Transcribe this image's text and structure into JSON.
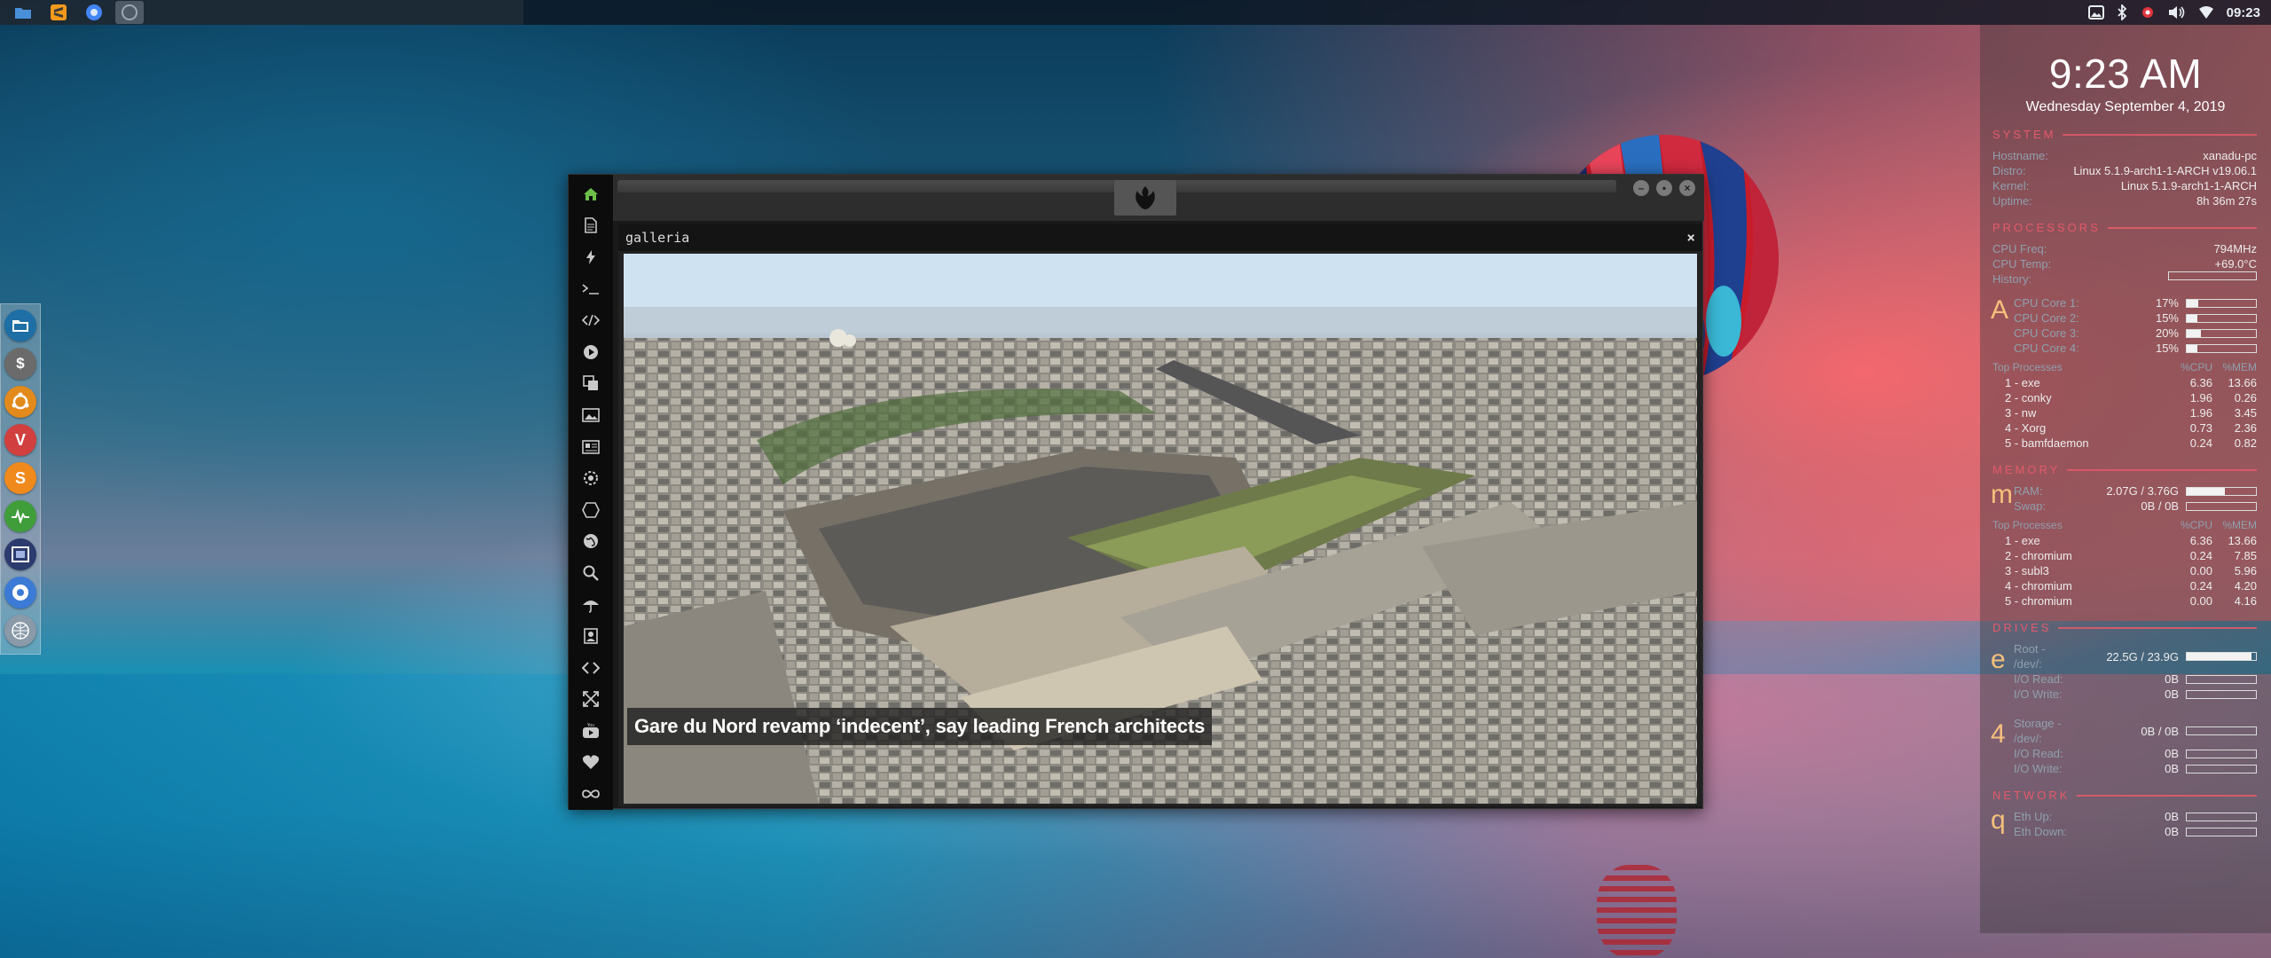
{
  "taskbar": {
    "launchers": [
      {
        "icon": "folder-icon",
        "color": "#4a90d9"
      },
      {
        "icon": "sublime-icon",
        "color": "#f29a1b"
      },
      {
        "icon": "chromium-icon",
        "color": "#4285f4"
      },
      {
        "icon": "app-icon",
        "color": "#556677"
      }
    ],
    "tray": {
      "icons": [
        "image-icon",
        "bluetooth-icon",
        "gear-icon",
        "volume-icon",
        "wifi-icon"
      ],
      "clock": "09:23"
    }
  },
  "dock": {
    "items": [
      {
        "icon": "file-manager-icon",
        "color": "#1d6fa5"
      },
      {
        "icon": "terminal-icon",
        "color": "#6b6b6b"
      },
      {
        "icon": "ubuntu-icon",
        "color": "#e38a1d"
      },
      {
        "icon": "vivaldi-icon",
        "color": "#d13f3f"
      },
      {
        "icon": "sublime-icon",
        "color": "#f08a1c"
      },
      {
        "icon": "system-monitor-icon",
        "color": "#3f9d3a"
      },
      {
        "icon": "screenshot-icon",
        "color": "#2b3b6e"
      },
      {
        "icon": "chromium-icon",
        "color": "#3b7bd6"
      },
      {
        "icon": "network-icon",
        "color": "#8a9aa8"
      }
    ]
  },
  "app": {
    "sidebar_icons": [
      "home-icon",
      "document-icon",
      "lightning-icon",
      "terminal-icon",
      "code-icon",
      "play-icon",
      "copy-icon",
      "image-icon",
      "news-icon",
      "settings-icon",
      "hexagon-icon",
      "globe-icon",
      "search-icon",
      "umbrella-icon",
      "contact-icon",
      "embed-icon",
      "expand-icon",
      "youtube-icon",
      "heart-icon",
      "infinity-icon"
    ],
    "panel_title": "galleria",
    "close_label": "×",
    "caption": "Gare du Nord revamp ‘indecent’, say leading French architects",
    "win_buttons": [
      "–",
      "▪",
      "×"
    ]
  },
  "conky": {
    "time": "9:23 AM",
    "date": "Wednesday September  4, 2019",
    "system": {
      "title": "SYSTEM",
      "rows": [
        {
          "k": "Hostname:",
          "v": "xanadu-pc"
        },
        {
          "k": "Distro:",
          "v": "Linux 5.1.9-arch1-1-ARCH v19.06.1"
        },
        {
          "k": "Kernel:",
          "v": "Linux 5.1.9-arch1-1-ARCH"
        },
        {
          "k": "Uptime:",
          "v": "8h 36m 27s"
        }
      ]
    },
    "processors": {
      "title": "PROCESSORS",
      "rows": [
        {
          "k": "CPU Freq:",
          "v": "794MHz"
        },
        {
          "k": "CPU Temp:",
          "v": "+69.0°C"
        },
        {
          "k": "History:",
          "v": ""
        }
      ],
      "letter": "A",
      "cores": [
        {
          "k": "CPU Core 1:",
          "v": "17%",
          "level": 0.17
        },
        {
          "k": "CPU Core 2:",
          "v": "15%",
          "level": 0.15
        },
        {
          "k": "CPU Core 3:",
          "v": "20%",
          "level": 0.2
        },
        {
          "k": "CPU Core 4:",
          "v": "15%",
          "level": 0.15
        }
      ],
      "proc_head": {
        "n": "Top Processes",
        "c1": "%CPU",
        "c2": "%MEM"
      },
      "procs": [
        {
          "n": "1  -  exe",
          "c1": "6.36",
          "c2": "13.66"
        },
        {
          "n": "2  -  conky",
          "c1": "1.96",
          "c2": "0.26"
        },
        {
          "n": "3  -  nw",
          "c1": "1.96",
          "c2": "3.45"
        },
        {
          "n": "4  -  Xorg",
          "c1": "0.73",
          "c2": "2.36"
        },
        {
          "n": "5  -  bamfdaemon",
          "c1": "0.24",
          "c2": "0.82"
        }
      ]
    },
    "memory": {
      "title": "MEMORY",
      "letter": "m",
      "rows": [
        {
          "k": "RAM:",
          "v": "2.07G / 3.76G",
          "level": 0.55
        },
        {
          "k": "Swap:",
          "v": "0B / 0B",
          "level": 0
        }
      ],
      "proc_head": {
        "n": "Top Processes",
        "c1": "%CPU",
        "c2": "%MEM"
      },
      "procs": [
        {
          "n": "1  -  exe",
          "c1": "6.36",
          "c2": "13.66"
        },
        {
          "n": "2  -  chromium",
          "c1": "0.24",
          "c2": "7.85"
        },
        {
          "n": "3  -  subl3",
          "c1": "0.00",
          "c2": "5.96"
        },
        {
          "n": "4  -  chromium",
          "c1": "0.24",
          "c2": "4.20"
        },
        {
          "n": "5  -  chromium",
          "c1": "0.00",
          "c2": "4.16"
        }
      ]
    },
    "storage": {
      "title": "DRIVES",
      "letter1": "e",
      "rows1": [
        {
          "k": "Root - /dev/:",
          "v": "22.5G / 23.9G",
          "level": 0.94
        },
        {
          "k": "I/O Read:",
          "v": "0B",
          "level": 0
        },
        {
          "k": "I/O Write:",
          "v": "0B",
          "level": 0
        }
      ],
      "letter2": "4",
      "rows2": [
        {
          "k": "Storage - /dev/:",
          "v": "0B / 0B",
          "level": 0
        },
        {
          "k": "I/O Read:",
          "v": "0B",
          "level": 0
        },
        {
          "k": "I/O Write:",
          "v": "0B",
          "level": 0
        }
      ]
    },
    "network": {
      "title": "NETWORK",
      "letter": "q",
      "rows": [
        {
          "k": "Eth Up:",
          "v": "0B",
          "level": 0
        },
        {
          "k": "Eth Down:",
          "v": "0B",
          "level": 0
        }
      ]
    }
  }
}
